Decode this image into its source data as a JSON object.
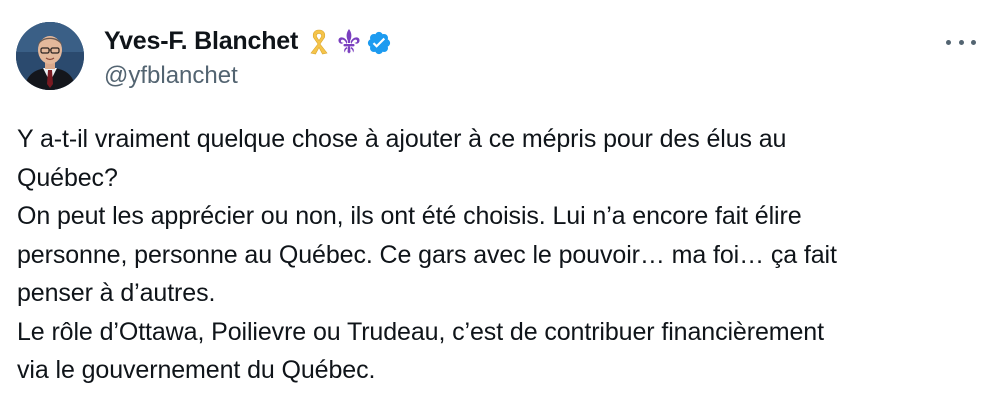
{
  "author": {
    "display_name": "Yves-F. Blanchet",
    "handle": "@yfblanchet"
  },
  "badges": [
    "yellow-ribbon-icon",
    "fleur-de-lis-icon",
    "verified-badge-icon"
  ],
  "colors": {
    "text": "#0f1419",
    "secondary": "#536471",
    "verified": "#1d9bf0",
    "ribbon": "#f5c44a",
    "fleur": "#7a3fbf"
  },
  "tweet": {
    "lines": [
      "Y a-t-il vraiment quelque chose à ajouter  à ce mépris pour des élus au",
      "Québec?",
      "On peut les apprécier ou non, ils ont été choisis. Lui n’a encore fait élire",
      "personne, personne au Québec. Ce gars avec le pouvoir… ma foi… ça fait",
      "penser à d’autres.",
      "Le rôle d’Ottawa, Poilievre ou Trudeau, c’est de contribuer financièrement",
      "via le gouvernement du Québec."
    ]
  }
}
